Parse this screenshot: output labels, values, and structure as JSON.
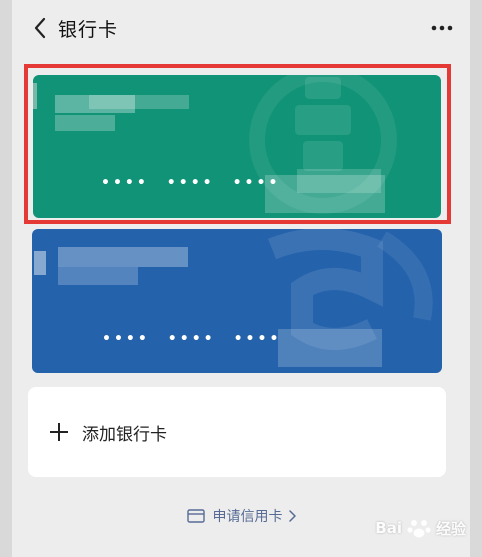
{
  "header": {
    "title": "银行卡"
  },
  "cards": [
    {
      "color": "#109376",
      "masked_dots": [
        "••••",
        "••••",
        "••••"
      ],
      "logo_icon": "bank-logo-icon"
    },
    {
      "color": "#2462ab",
      "masked_dots": [
        "••••",
        "••••",
        "••••"
      ],
      "logo_icon": "bank-logo-icon"
    }
  ],
  "add_card": {
    "label": "添加银行卡"
  },
  "apply_credit": {
    "label": "申请信用卡"
  },
  "watermark": {
    "text": "Bai",
    "suffix": "经验"
  },
  "colors": {
    "highlight": "#e53935",
    "link": "#576b95",
    "background": "#ededed"
  }
}
